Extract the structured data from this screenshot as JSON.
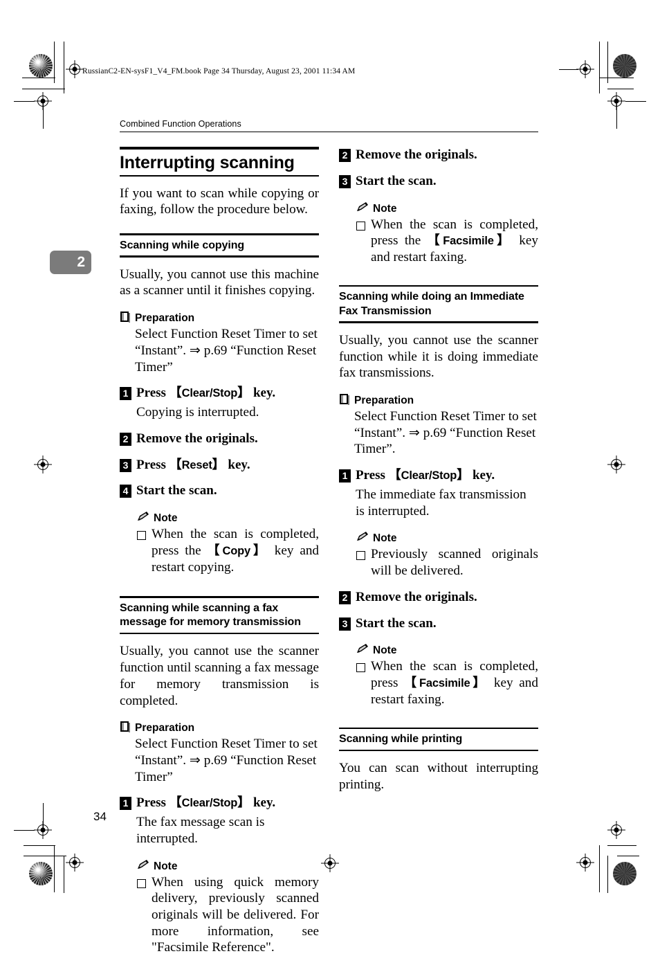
{
  "page": {
    "file_stamp": "RussianC2-EN-sysF1_V4_FM.book  Page 34  Thursday, August 23, 2001  11:34 AM",
    "running_head": "Combined Function Operations",
    "chapter_tab": "2",
    "folio": "34",
    "accent_gray": "#7b7b7b",
    "ink": "#000000"
  },
  "icons": {
    "preparation": "book-icon",
    "note": "pencil-icon",
    "bullet": "hollow-square-bullet",
    "registration": "registration-target-icon",
    "halftone": "halftone-circle-icon"
  },
  "left_column": {
    "title": "Interrupting scanning",
    "intro": "If you want to scan while copying or faxing, follow the procedure below.",
    "section_1": {
      "heading": "Scanning while copying",
      "intro": "Usually, you cannot use this machine as a scanner until it finishes copying.",
      "preparation": {
        "label": "Preparation",
        "text": "Select Function Reset Timer to set “Instant”. ⇒ p.69 “Function Reset Timer”"
      },
      "steps": [
        {
          "num": "1",
          "text_before": "Press ",
          "key": "Clear/Stop",
          "text_after": " key.",
          "follow_up": "Copying is interrupted."
        },
        {
          "num": "2",
          "text_before": "Remove the originals.",
          "key": "",
          "text_after": "",
          "follow_up": ""
        },
        {
          "num": "3",
          "text_before": "Press ",
          "key": "Reset",
          "text_after": " key.",
          "follow_up": ""
        },
        {
          "num": "4",
          "text_before": "Start the scan.",
          "key": "",
          "text_after": "",
          "follow_up": ""
        }
      ],
      "note": {
        "label": "Note",
        "items": [
          {
            "text_before": "When the scan is completed, press the ",
            "key": "Copy",
            "text_after": " key and restart copying."
          }
        ]
      }
    },
    "section_2": {
      "heading": "Scanning while scanning a fax message for memory transmission",
      "intro": "Usually, you cannot use the scanner function until scanning a fax message for memory transmission is completed.",
      "preparation": {
        "label": "Preparation",
        "text": "Select Function Reset Timer to set “Instant”. ⇒ p.69 “Function Reset Timer”"
      },
      "steps": [
        {
          "num": "1",
          "text_before": "Press ",
          "key": "Clear/Stop",
          "text_after": " key.",
          "follow_up": "The fax message scan is interrupted."
        }
      ],
      "note": {
        "label": "Note",
        "items": [
          {
            "text_before": "When using quick memory delivery, previously scanned originals will be delivered. For more information, see \"Facsimile Reference\".",
            "key": "",
            "text_after": ""
          }
        ]
      }
    }
  },
  "right_column": {
    "continued_steps": [
      {
        "num": "2",
        "text_before": "Remove the originals.",
        "key": "",
        "text_after": ""
      },
      {
        "num": "3",
        "text_before": "Start the scan.",
        "key": "",
        "text_after": ""
      }
    ],
    "continued_note": {
      "label": "Note",
      "items": [
        {
          "text_before": "When the scan is completed, press the ",
          "key": "Facsimile",
          "text_after": " key and restart faxing."
        }
      ]
    },
    "section_3": {
      "heading": "Scanning while doing an Immediate Fax Transmission",
      "intro": "Usually, you cannot use the scanner function while it is doing immediate fax transmissions.",
      "preparation": {
        "label": "Preparation",
        "text": "Select Function Reset Timer to set “Instant”. ⇒ p.69 “Function Reset Timer”."
      },
      "step_1": {
        "num": "1",
        "text_before": "Press ",
        "key": "Clear/Stop",
        "text_after": " key.",
        "follow_up": "The immediate fax transmission is interrupted."
      },
      "note_1": {
        "label": "Note",
        "items": [
          {
            "text_before": "Previously scanned originals will be delivered.",
            "key": "",
            "text_after": ""
          }
        ]
      },
      "step_2": {
        "num": "2",
        "text_before": "Remove the originals.",
        "key": "",
        "text_after": ""
      },
      "step_3": {
        "num": "3",
        "text_before": "Start the scan.",
        "key": "",
        "text_after": ""
      },
      "note_2": {
        "label": "Note",
        "items": [
          {
            "text_before": "When the scan is completed, press ",
            "key": "Facsimile",
            "text_after": " key and restart faxing."
          }
        ]
      }
    },
    "section_4": {
      "heading": "Scanning while printing",
      "intro": "You can scan without interrupting printing."
    }
  }
}
